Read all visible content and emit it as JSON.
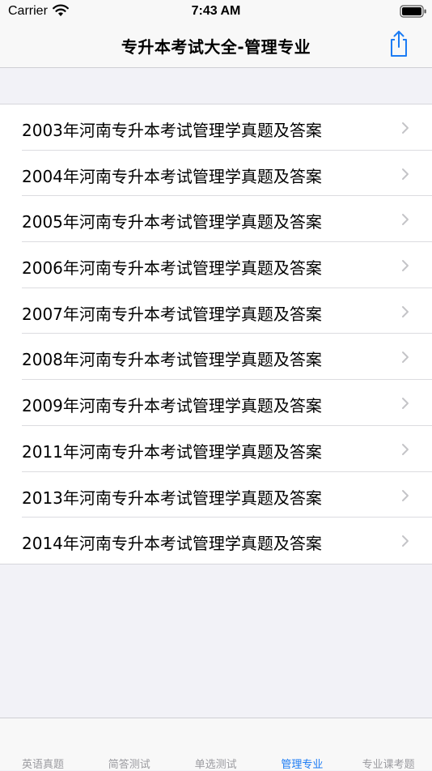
{
  "status_bar": {
    "carrier": "Carrier",
    "time": "7:43 AM"
  },
  "nav": {
    "title": "专升本考试大全-管理专业",
    "share_icon": "share-icon"
  },
  "list": [
    "2003年河南专升本考试管理学真题及答案",
    "2004年河南专升本考试管理学真题及答案",
    "2005年河南专升本考试管理学真题及答案",
    "2006年河南专升本考试管理学真题及答案",
    "2007年河南专升本考试管理学真题及答案",
    "2008年河南专升本考试管理学真题及答案",
    "2009年河南专升本考试管理学真题及答案",
    "2011年河南专升本考试管理学真题及答案",
    "2013年河南专升本考试管理学真题及答案",
    "2014年河南专升本考试管理学真题及答案"
  ],
  "tabs": [
    {
      "label": "英语真题",
      "active": false
    },
    {
      "label": "简答测试",
      "active": false
    },
    {
      "label": "单选测试",
      "active": false
    },
    {
      "label": "管理专业",
      "active": true
    },
    {
      "label": "专业课考题",
      "active": false
    }
  ],
  "colors": {
    "accent": "#1c7cf4",
    "tab_inactive": "#9b9ba0",
    "background": "#f2f2f7"
  }
}
